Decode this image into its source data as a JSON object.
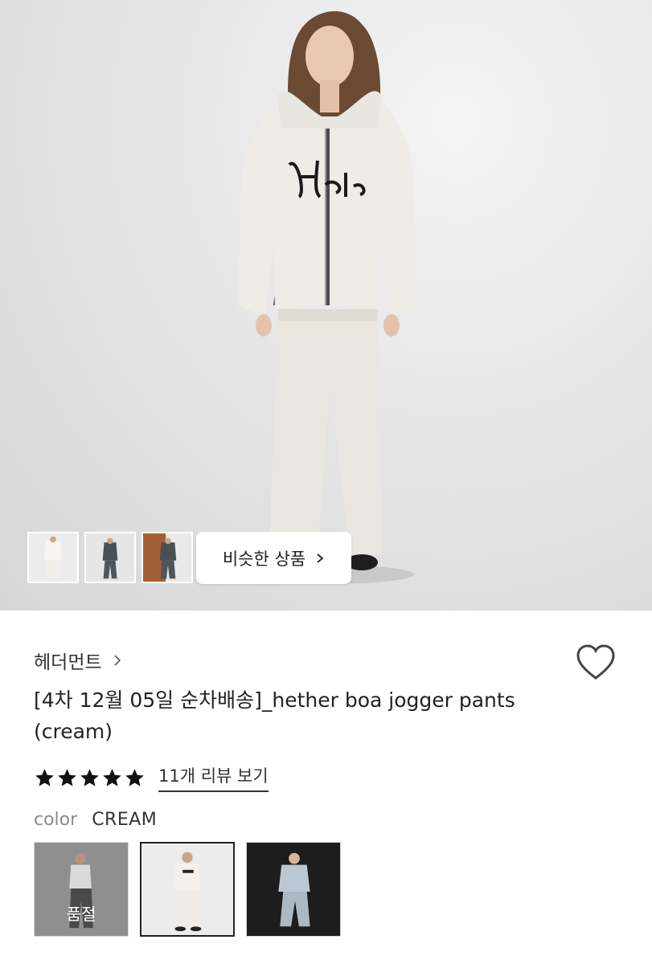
{
  "hero": {
    "thumbnails": [
      "thumb-cream-outfit",
      "thumb-charcoal-outfit",
      "thumb-charcoal-outfit-wood-backdrop"
    ],
    "similar_label": "비슷한 상품"
  },
  "product": {
    "brand": "헤더먼트",
    "title": "[4차 12월 05일 순차배송]_hether boa jogger pants (cream)",
    "rating_stars": 5,
    "review_link": "11개 리뷰 보기",
    "color_label": "color",
    "color_value": "CREAM",
    "swatches": [
      {
        "status": "품절"
      },
      {
        "status": ""
      },
      {
        "status": ""
      }
    ]
  },
  "icons": {
    "heart": "heart-outline-icon",
    "star": "star-icon",
    "chevron": "chevron-right-icon"
  },
  "colors": {
    "text": "#222222",
    "muted": "#8a8a8a",
    "star": "#111111"
  }
}
